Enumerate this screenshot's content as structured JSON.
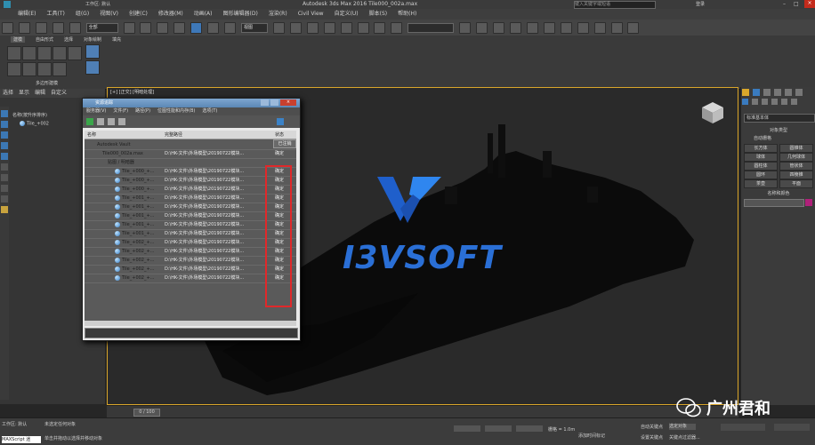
{
  "window": {
    "title": "Autodesk 3ds Max 2016    Tile000_002a.max",
    "workspace": "工作区: 默认",
    "search_placeholder": "键入关键字或短语",
    "login": "登录"
  },
  "menu": [
    "编辑(E)",
    "工具(T)",
    "组(G)",
    "视图(V)",
    "创建(C)",
    "修改器(M)",
    "动画(A)",
    "图形编辑器(D)",
    "渲染(R)",
    "Civil View",
    "自定义(U)",
    "脚本(S)",
    "帮助(H)"
  ],
  "toolbar": {
    "filter": "全部",
    "view": "视图"
  },
  "ribbon": {
    "tabs": [
      "建模",
      "自由形式",
      "选择",
      "对象绘制",
      "填充"
    ],
    "group": "多边形建模"
  },
  "scene_explorer_header": [
    "选择",
    "显示",
    "编辑",
    "自定义"
  ],
  "scene_tree": {
    "header": "名称(按升序排序)",
    "item": "Tile_+002"
  },
  "viewport": {
    "label": "[+] [正交] [明暗处理]"
  },
  "logo": {
    "text": "I3VSOFT"
  },
  "dialog": {
    "title": "资源追踪",
    "menu": [
      "服务器(V)",
      "文件(F)",
      "路径(P)",
      "位图性能和内存(B)",
      "选项(T)"
    ],
    "columns": {
      "name": "名称",
      "path": "完整路径",
      "status": "状态"
    },
    "status_box": "已注销",
    "rows": [
      {
        "name": "Autodesk Vault",
        "path": "",
        "status": ""
      },
      {
        "name": "Tile000_002a.max",
        "path": "D:\\HK-文件\\外场模型\\20190722模块...",
        "status": "确定"
      },
      {
        "name": "贴图 / 明暗器",
        "path": "",
        "status": ""
      },
      {
        "name": "Tile_+000_+...",
        "path": "D:\\HK-文件\\外场模型\\20190722模块...",
        "status": "确定"
      },
      {
        "name": "Tile_+000_+...",
        "path": "D:\\HK-文件\\外场模型\\20190722模块...",
        "status": "确定"
      },
      {
        "name": "Tile_+000_+...",
        "path": "D:\\HK-文件\\外场模型\\20190722模块...",
        "status": "确定"
      },
      {
        "name": "Tile_+001_+...",
        "path": "D:\\HK-文件\\外场模型\\20190722模块...",
        "status": "确定"
      },
      {
        "name": "Tile_+001_+...",
        "path": "D:\\HK-文件\\外场模型\\20190722模块...",
        "status": "确定"
      },
      {
        "name": "Tile_+001_+...",
        "path": "D:\\HK-文件\\外场模型\\20190722模块...",
        "status": "确定"
      },
      {
        "name": "Tile_+001_+...",
        "path": "D:\\HK-文件\\外场模型\\20190722模块...",
        "status": "确定"
      },
      {
        "name": "Tile_+001_+...",
        "path": "D:\\HK-文件\\外场模型\\20190722模块...",
        "status": "确定"
      },
      {
        "name": "Tile_+002_+...",
        "path": "D:\\HK-文件\\外场模型\\20190722模块...",
        "status": "确定"
      },
      {
        "name": "Tile_+002_+...",
        "path": "D:\\HK-文件\\外场模型\\20190722模块...",
        "status": "确定"
      },
      {
        "name": "Tile_+002_+...",
        "path": "D:\\HK-文件\\外场模型\\20190722模块...",
        "status": "确定"
      },
      {
        "name": "Tile_+002_+...",
        "path": "D:\\HK-文件\\外场模型\\20190722模块...",
        "status": "确定"
      },
      {
        "name": "Tile_+002_+...",
        "path": "D:\\HK-文件\\外场模型\\20190722模块...",
        "status": "确定"
      }
    ]
  },
  "command_panel": {
    "dropdown": "标准基本体",
    "section_title": "对象类型",
    "autogrid": "自动栅格",
    "buttons": [
      "长方体",
      "圆锥体",
      "球体",
      "几何球体",
      "圆柱体",
      "管状体",
      "圆环",
      "四棱锥",
      "茶壶",
      "平面"
    ],
    "name_color": "名称和颜色"
  },
  "timeline": {
    "frame": "0 / 100"
  },
  "status": {
    "line1": "未选定任何对象",
    "line2": "单击并拖动以选择并移动对象",
    "script": "MAXScript 迷",
    "grid": "栅格 = 1.0m",
    "autokey": "自动关键点",
    "setkey": "设置关键点",
    "selected": "选定对象",
    "filter": "关键点过滤器...",
    "addtime": "添加时间标记"
  },
  "watermark": "广州君和"
}
